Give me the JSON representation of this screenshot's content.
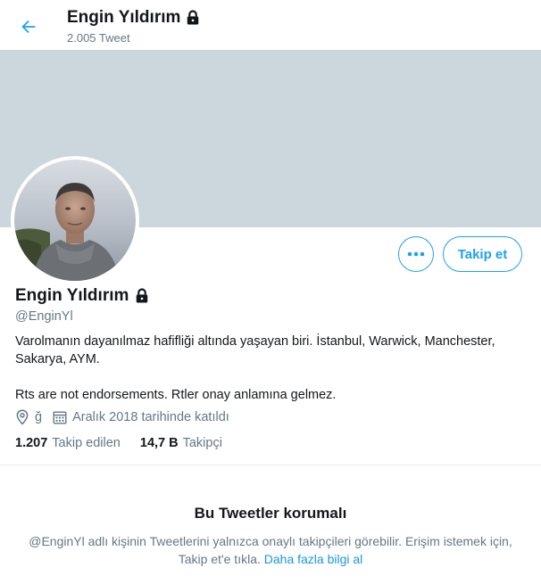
{
  "header": {
    "title": "Engin Yıldırım",
    "tweet_count": "2.005 Tweet"
  },
  "profile": {
    "name": "Engin Yıldırım",
    "handle": "@EnginYl",
    "bio_line1": "Varolmanın dayanılmaz hafifliği altında yaşayan biri. İstanbul, Warwick, Manchester, Sakarya, AYM.",
    "bio_line2": "Rts are not endorsements. Rtler onay anlamına gelmez.",
    "location": "ğ",
    "joined": "Aralık 2018 tarihinde katıldı",
    "following_count": "1.207",
    "following_label": "Takip edilen",
    "followers_count": "14,7 B",
    "followers_label": "Takipçi"
  },
  "actions": {
    "follow_label": "Takip et",
    "more_icon": "more-icon"
  },
  "protected": {
    "title": "Bu Tweetler korumalı",
    "text": "@EnginYl adlı kişinin Tweetlerini yalnızca onaylı takipçileri görebilir. Erişim istemek için, Takip et'e tıkla.",
    "link": "Daha fazla bilgi al"
  },
  "colors": {
    "accent": "#1da1f2",
    "banner": "#ccd6dd",
    "secondary_text": "#657786"
  }
}
